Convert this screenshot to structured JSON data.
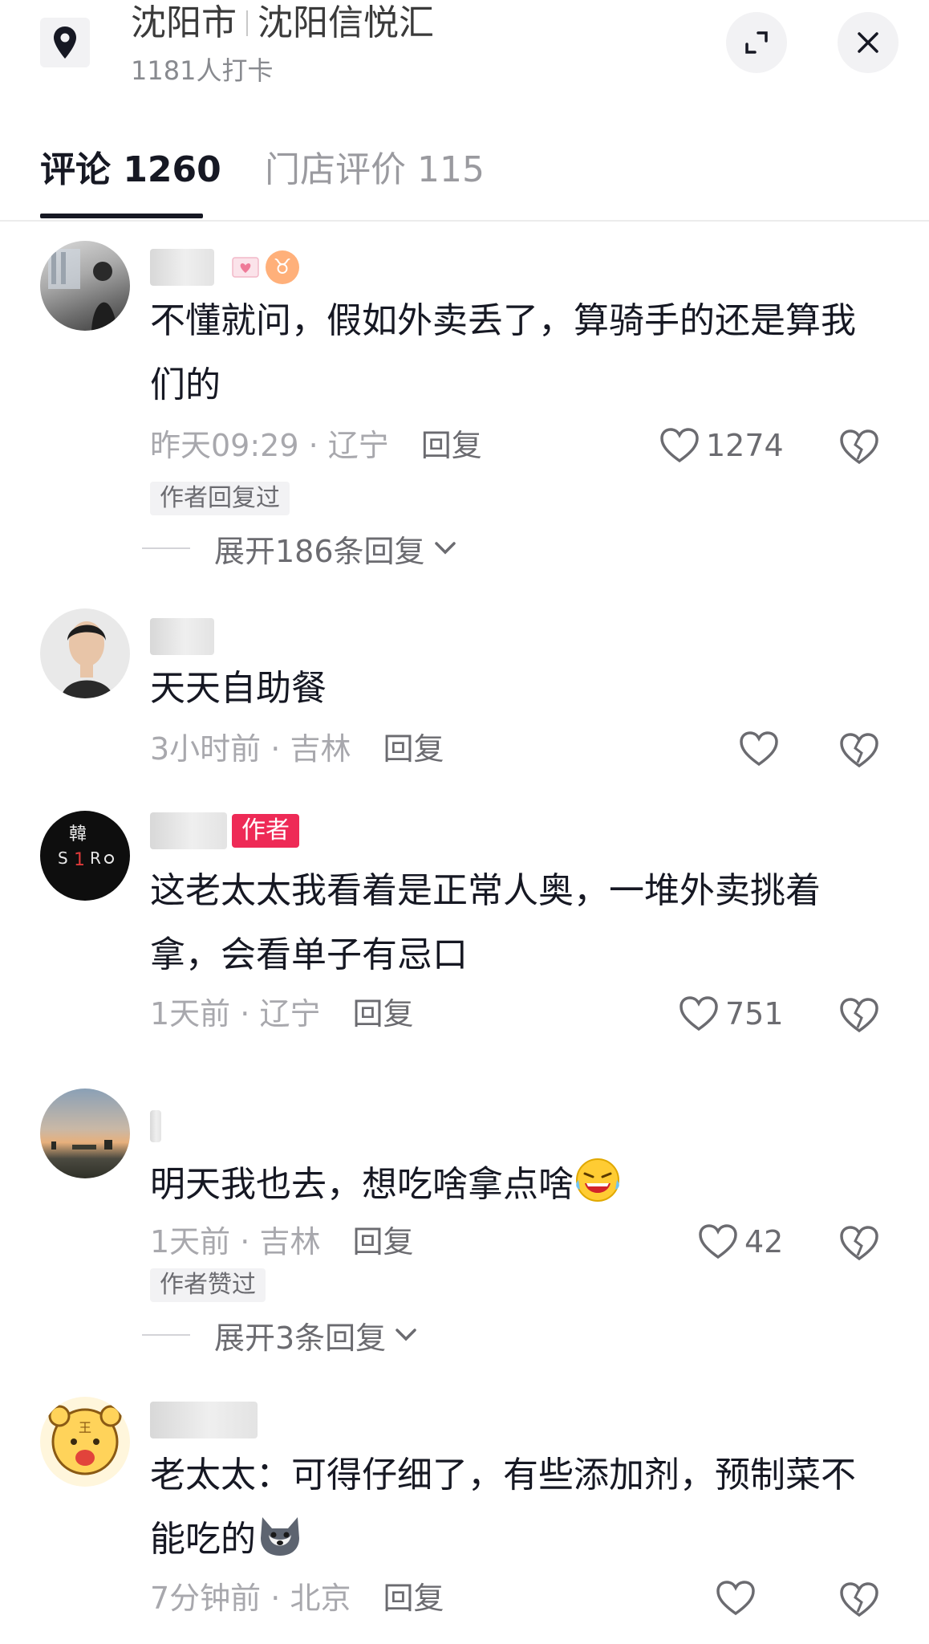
{
  "header": {
    "city": "沈阳市",
    "place": "沈阳信悦汇",
    "checkin": "1181人打卡",
    "icons": {
      "location": "location-pin-icon",
      "expand": "expand-icon",
      "close": "close-icon"
    }
  },
  "tabs": [
    {
      "label": "评论 1260",
      "active": true
    },
    {
      "label": "门店评价 115",
      "active": false
    }
  ],
  "comments": [
    {
      "text": "不懂就问，假如外卖丢了，算骑手的还是算我们的",
      "time": "昨天09:29",
      "location": "辽宁",
      "reply_label": "回复",
      "likes": "1274",
      "badge": "作者回复过",
      "expand": "展开186条回复",
      "zodiac": "♉"
    },
    {
      "text": "天天自助餐",
      "time": "3小时前",
      "location": "吉林",
      "reply_label": "回复"
    },
    {
      "text": "这老太太我看着是正常人奥，一堆外卖挑着拿，会看单子有忌口",
      "time": "1天前",
      "location": "辽宁",
      "reply_label": "回复",
      "likes": "751",
      "author_tag": "作者"
    },
    {
      "text": "明天我也去，想吃啥拿点啥",
      "time": "1天前",
      "location": "吉林",
      "reply_label": "回复",
      "likes": "42",
      "badge": "作者赞过",
      "expand": "展开3条回复",
      "emoji": "laughing-crying-emoji"
    },
    {
      "text": "老太太：可得仔细了，有些添加剂，预制菜不能吃的",
      "time": "7分钟前",
      "location": "北京",
      "reply_label": "回复",
      "emoji": "husky-emoji"
    }
  ],
  "colors": {
    "author_tag": "#ee2a56",
    "text": "#161823",
    "meta": "#a8a8ad"
  }
}
